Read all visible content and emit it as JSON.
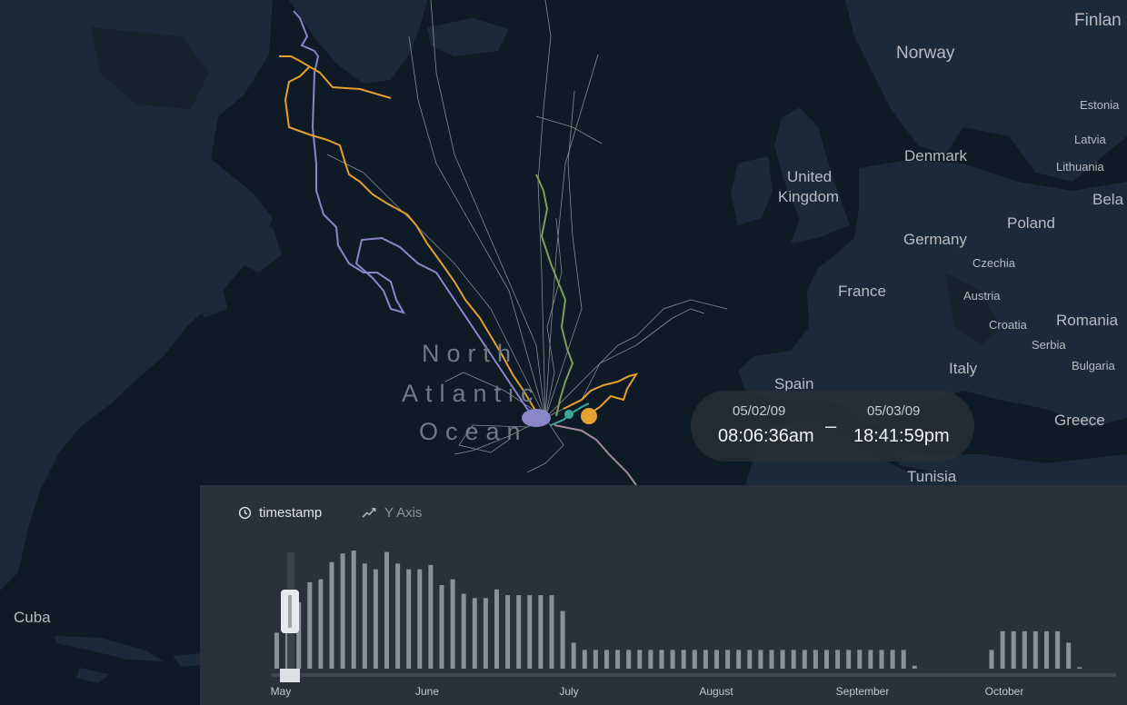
{
  "map": {
    "countries": [
      {
        "id": "norway",
        "label": "Norway",
        "size": "lg"
      },
      {
        "id": "finland",
        "label": "Finlan",
        "size": "lg"
      },
      {
        "id": "estonia",
        "label": "Estonia",
        "size": "sm"
      },
      {
        "id": "latvia",
        "label": "Latvia",
        "size": "sm"
      },
      {
        "id": "lithuania",
        "label": "Lithuania",
        "size": "sm"
      },
      {
        "id": "denmark",
        "label": "Denmark",
        "size": "md"
      },
      {
        "id": "uk-1",
        "label": "United",
        "size": "md"
      },
      {
        "id": "uk-2",
        "label": "Kingdom",
        "size": "md"
      },
      {
        "id": "belarus",
        "label": "Bela",
        "size": "md"
      },
      {
        "id": "poland",
        "label": "Poland",
        "size": "md"
      },
      {
        "id": "germany",
        "label": "Germany",
        "size": "md"
      },
      {
        "id": "czechia",
        "label": "Czechia",
        "size": "sm"
      },
      {
        "id": "france",
        "label": "France",
        "size": "md"
      },
      {
        "id": "austria",
        "label": "Austria",
        "size": "sm"
      },
      {
        "id": "croatia",
        "label": "Croatia",
        "size": "sm"
      },
      {
        "id": "romania",
        "label": "Romania",
        "size": "md"
      },
      {
        "id": "serbia",
        "label": "Serbia",
        "size": "sm"
      },
      {
        "id": "bulgaria",
        "label": "Bulgaria",
        "size": "sm"
      },
      {
        "id": "italy",
        "label": "Italy",
        "size": "md"
      },
      {
        "id": "spain",
        "label": "Spain",
        "size": "md"
      },
      {
        "id": "greece",
        "label": "Greece",
        "size": "md"
      },
      {
        "id": "tunisia",
        "label": "Tunisia",
        "size": "md"
      },
      {
        "id": "cuba",
        "label": "Cuba",
        "size": "md"
      }
    ],
    "ocean": [
      "North",
      "Atlantic",
      "Ocean"
    ],
    "colors": {
      "water": "#0e1a26",
      "land": "#1b2a3a",
      "track_orange": "#e5a030",
      "track_purple": "#8b85c9",
      "track_green": "#7ba05b",
      "track_teal": "#3aa89a",
      "track_gray": "#c8cdd2"
    }
  },
  "time_range": {
    "start_date": "05/02/09",
    "start_time": "08:06:36am",
    "separator": "–",
    "end_date": "05/03/09",
    "end_time": "18:41:59pm"
  },
  "timeline": {
    "tabs": [
      {
        "label": "timestamp",
        "icon": "clock-icon",
        "active": true
      },
      {
        "label": "Y Axis",
        "icon": "line-chart-icon",
        "active": false
      }
    ],
    "months": [
      "May",
      "June",
      "July",
      "August",
      "September",
      "October"
    ],
    "bar_color": "#8a919a",
    "selected_bar_color": "#a3aab3"
  },
  "chart_data": {
    "type": "bar",
    "title": "",
    "xlabel": "",
    "ylabel": "",
    "x_ticks": [
      "May",
      "June",
      "July",
      "August",
      "September",
      "October"
    ],
    "values": [
      25,
      51,
      46,
      60,
      62,
      74,
      80,
      82,
      73,
      69,
      81,
      73,
      69,
      69,
      72,
      58,
      62,
      52,
      49,
      49,
      55,
      51,
      51,
      51,
      51,
      51,
      40,
      18,
      13,
      13,
      13,
      13,
      13,
      13,
      13,
      13,
      13,
      13,
      13,
      13,
      13,
      13,
      13,
      13,
      13,
      13,
      13,
      13,
      13,
      13,
      13,
      13,
      13,
      13,
      13,
      13,
      13,
      13,
      2,
      0,
      0,
      0,
      0,
      0,
      0,
      13,
      26,
      26,
      26,
      26,
      26,
      26,
      18,
      1,
      0,
      0,
      0,
      0,
      0,
      0,
      0,
      0,
      4,
      13,
      13,
      13,
      13,
      13,
      13,
      13,
      13
    ],
    "selected_range": [
      "05/02/09 08:06:36am",
      "05/03/09 18:41:59pm"
    ]
  }
}
